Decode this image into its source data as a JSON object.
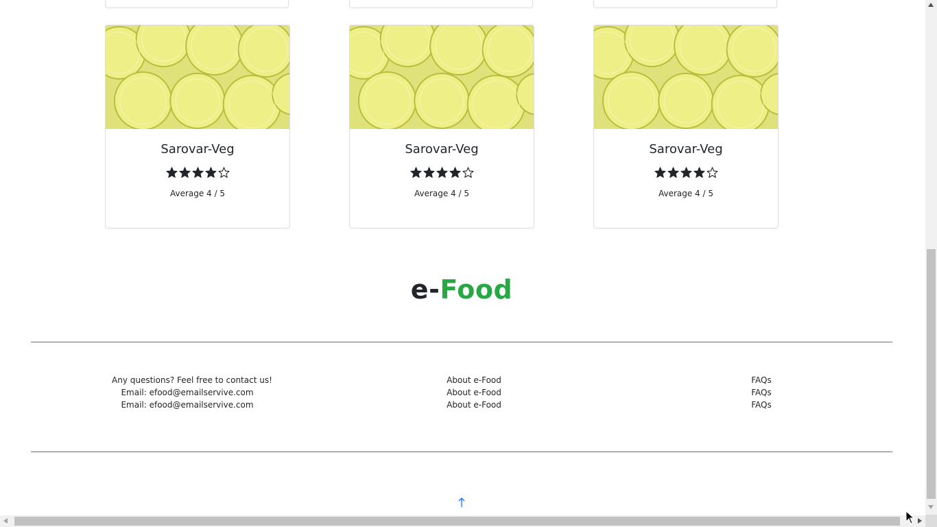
{
  "cards": [
    {
      "title": "Sarovar-Veg",
      "rating": 4,
      "max_rating": 5,
      "average_text": "Average 4 / 5"
    },
    {
      "title": "Sarovar-Veg",
      "rating": 4,
      "max_rating": 5,
      "average_text": "Average 4 / 5"
    },
    {
      "title": "Sarovar-Veg",
      "rating": 4,
      "max_rating": 5,
      "average_text": "Average 4 / 5"
    }
  ],
  "brand": {
    "prefix": "e-",
    "name": "Food",
    "accent_color": "#28a745"
  },
  "footer": {
    "contact": [
      "Any questions? Feel free to contact us!",
      "Email: efood@emailservive.com",
      "Email: efood@emailservive.com"
    ],
    "about": [
      "About e-Food",
      "About e-Food",
      "About e-Food"
    ],
    "faqs": [
      "FAQs",
      "FAQs",
      "FAQs"
    ]
  },
  "icons": {
    "back_to_top": "arrow-up-icon",
    "star_filled": "star-filled-icon",
    "star_empty": "star-outline-icon"
  },
  "colors": {
    "arrow": "#0d6efd",
    "text": "#212529"
  }
}
